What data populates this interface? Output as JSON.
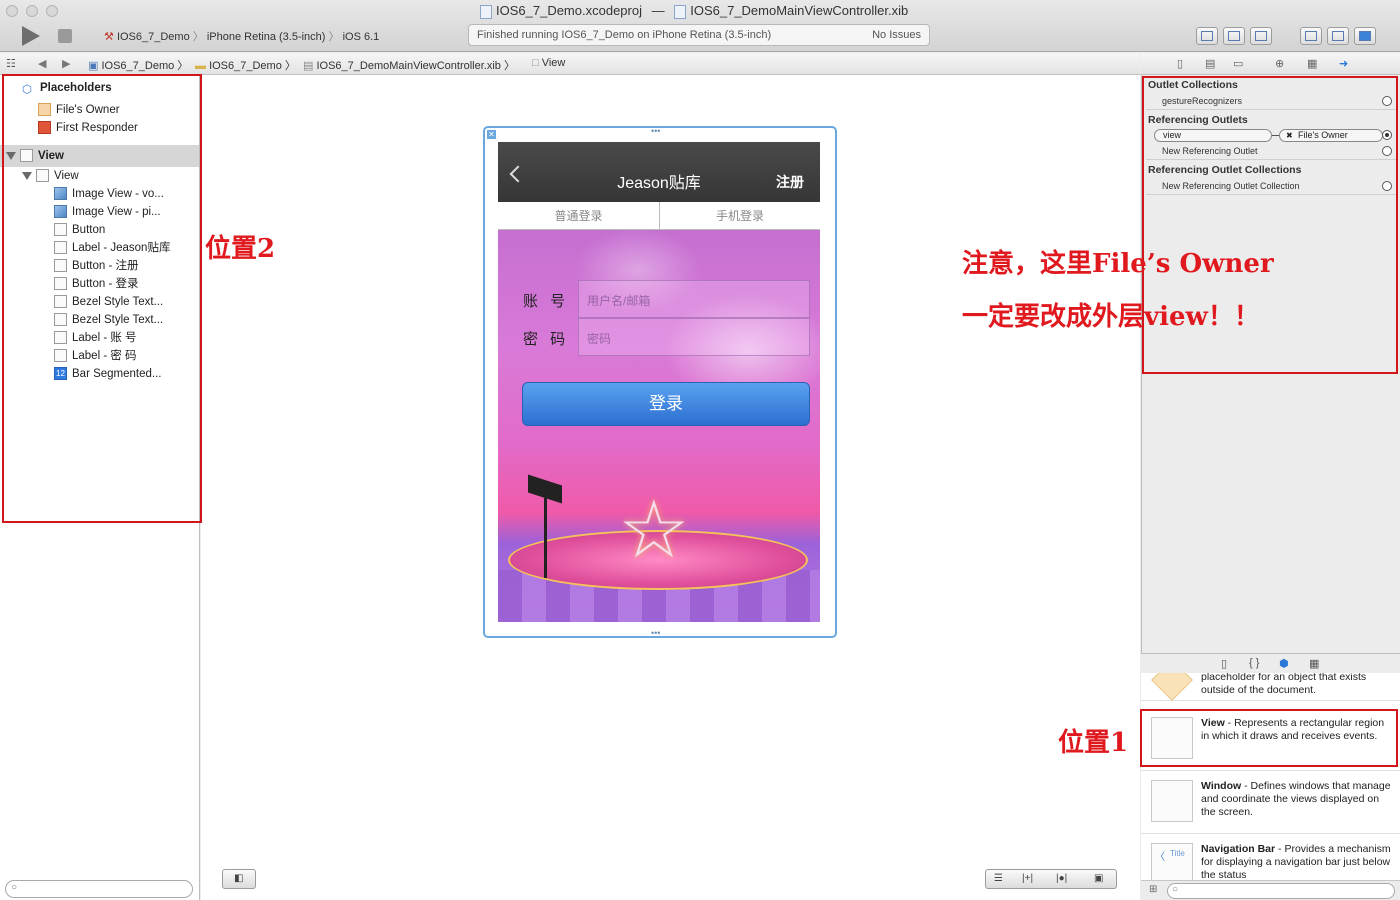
{
  "window": {
    "project_file": "IOS6_7_Demo.xcodeproj",
    "separator": "—",
    "xib_file": "IOS6_7_DemoMainViewController.xib"
  },
  "toolbar": {
    "scheme": "IOS6_7_Demo",
    "destination": "iPhone Retina (3.5-inch)",
    "sdk": "iOS 6.1",
    "activity": "Finished running IOS6_7_Demo on iPhone Retina (3.5-inch)",
    "issues": "No Issues"
  },
  "jumpbar": {
    "items": [
      "IOS6_7_Demo",
      "IOS6_7_Demo",
      "IOS6_7_DemoMainViewController.xib",
      "View"
    ]
  },
  "outline": {
    "placeholders_header": "Placeholders",
    "files_owner": "File's Owner",
    "first_responder": "First Responder",
    "view_header": "View",
    "view_child": "View",
    "children": [
      "Image View - vo...",
      "Image View - pi...",
      "Button",
      "Label - Jeason贴库",
      "Button - 注册",
      "Button - 登录",
      "Bezel Style Text...",
      "Bezel Style Text...",
      "Label - 账 号",
      "Label - 密 码",
      "Bar Segmented..."
    ]
  },
  "device": {
    "nav_title": "Jeason贴库",
    "nav_right": "注册",
    "seg_left": "普通登录",
    "seg_right": "手机登录",
    "account_label": "账 号",
    "password_label": "密 码",
    "account_placeholder": "用户名/邮箱",
    "password_placeholder": "密码",
    "login_button": "登录"
  },
  "inspector": {
    "outlet_collections": "Outlet Collections",
    "gesture_recognizers": "gestureRecognizers",
    "referencing_outlets": "Referencing Outlets",
    "ref_view": "view",
    "ref_owner": "File's Owner",
    "new_ref_outlet": "New Referencing Outlet",
    "referencing_outlet_collections": "Referencing Outlet Collections",
    "new_ref_outlet_collection": "New Referencing Outlet Collection"
  },
  "library": {
    "partial_text": "placeholder for an object that exists outside of the document.",
    "items": [
      {
        "name": "View",
        "desc": " - Represents a rectangular region in which it draws and receives events."
      },
      {
        "name": "Window",
        "desc": " - Defines windows that manage and coordinate the views displayed on the screen."
      },
      {
        "name": "Navigation Bar",
        "desc": " - Provides a mechanism for displaying a navigation bar just below the status"
      }
    ],
    "nav_icon_title": "Title"
  },
  "annotations": {
    "pos2": "位置2",
    "pos1": "位置1",
    "note_line1": "注意，这里File’s Owner",
    "note_line2": "一定要改成外层view！！",
    "color": "#e0191f"
  }
}
